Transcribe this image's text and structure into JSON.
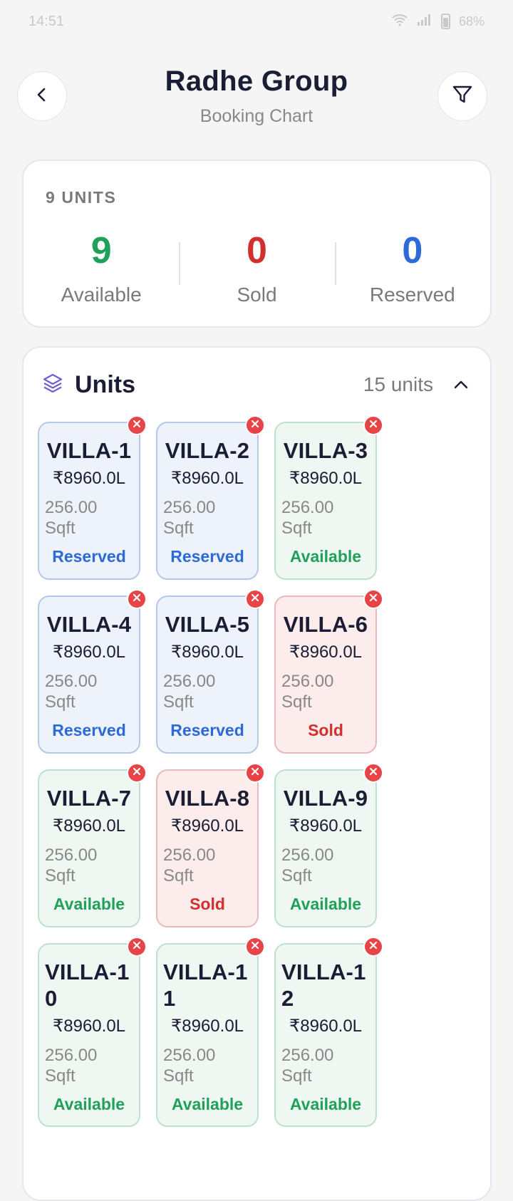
{
  "status_bar": {
    "time": "14:51",
    "battery": "68%"
  },
  "header": {
    "title": "Radhe Group",
    "subtitle": "Booking Chart"
  },
  "summary": {
    "label": "9 UNITS",
    "stats": [
      {
        "value": "9",
        "label": "Available",
        "color": "#21a05a"
      },
      {
        "value": "0",
        "label": "Sold",
        "color": "#d22f2f"
      },
      {
        "value": "0",
        "label": "Reserved",
        "color": "#2b6ad8"
      }
    ]
  },
  "units": {
    "title": "Units",
    "count_label": "15 units",
    "items": [
      {
        "name": "VILLA-1",
        "price": "₹8960.0L",
        "area": "256.00 Sqft",
        "status": "Reserved"
      },
      {
        "name": "VILLA-2",
        "price": "₹8960.0L",
        "area": "256.00 Sqft",
        "status": "Reserved"
      },
      {
        "name": "VILLA-3",
        "price": "₹8960.0L",
        "area": "256.00 Sqft",
        "status": "Available"
      },
      {
        "name": "VILLA-4",
        "price": "₹8960.0L",
        "area": "256.00 Sqft",
        "status": "Reserved"
      },
      {
        "name": "VILLA-5",
        "price": "₹8960.0L",
        "area": "256.00 Sqft",
        "status": "Reserved"
      },
      {
        "name": "VILLA-6",
        "price": "₹8960.0L",
        "area": "256.00 Sqft",
        "status": "Sold"
      },
      {
        "name": "VILLA-7",
        "price": "₹8960.0L",
        "area": "256.00 Sqft",
        "status": "Available"
      },
      {
        "name": "VILLA-8",
        "price": "₹8960.0L",
        "area": "256.00 Sqft",
        "status": "Sold"
      },
      {
        "name": "VILLA-9",
        "price": "₹8960.0L",
        "area": "256.00 Sqft",
        "status": "Available"
      },
      {
        "name": "VILLA-10",
        "price": "₹8960.0L",
        "area": "256.00 Sqft",
        "status": "Available"
      },
      {
        "name": "VILLA-11",
        "price": "₹8960.0L",
        "area": "256.00 Sqft",
        "status": "Available"
      },
      {
        "name": "VILLA-12",
        "price": "₹8960.0L",
        "area": "256.00 Sqft",
        "status": "Available"
      }
    ]
  },
  "icons": {
    "back": "chevron-left-icon",
    "filter": "filter-icon",
    "units": "layers-icon",
    "collapse": "chevron-up-icon",
    "remove": "close-icon"
  }
}
